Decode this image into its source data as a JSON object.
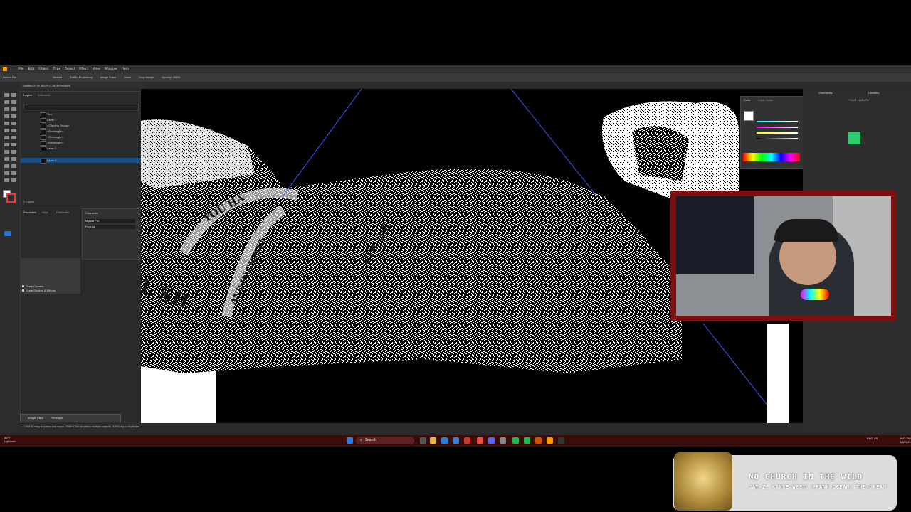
{
  "menu": [
    "File",
    "Edit",
    "Object",
    "Type",
    "Select",
    "Effect",
    "View",
    "Window",
    "Help"
  ],
  "control_bar": {
    "selection": "Linked File",
    "buttons": [
      "Embed",
      "Edit In Photoshop",
      "Image Trace",
      "Mask",
      "Crop Image",
      "Opacity: 100%"
    ]
  },
  "document_tab": "Untitled-1* @ 300 % (CMYK/Preview)",
  "layers_panel": {
    "tabs": [
      "Layers",
      "Artboards"
    ],
    "rows": [
      {
        "name": "Text",
        "selected": false
      },
      {
        "name": "Layer 1",
        "selected": false
      },
      {
        "name": "<Clipping Group>",
        "selected": false
      },
      {
        "name": "<Rectangle>",
        "selected": false
      },
      {
        "name": "<Rectangle>",
        "selected": false
      },
      {
        "name": "<Rectangle>",
        "selected": false
      },
      {
        "name": "Layer 2",
        "selected": false
      },
      {
        "name": "Layer 3",
        "selected": true
      }
    ],
    "count": "3 Layers"
  },
  "props_panel": {
    "tabs": [
      "Properties",
      "Align",
      "Pathfinder"
    ],
    "character_title": "Character",
    "font": "Myriad Pro",
    "style": "Regular",
    "checkboxes": [
      "Scale Corners",
      "Scale Strokes & Effects"
    ]
  },
  "image_trace": {
    "label": "Image Trace",
    "btn": "Reshape"
  },
  "status_text": "Click & drag to select and move, Shift+Click to select multiple objects, Alt+Drag to duplicate",
  "color_panel": {
    "tabs": [
      "Color",
      "Color Guide"
    ]
  },
  "right_panel": {
    "tabs": [
      "Comments",
      "Libraries"
    ],
    "library": "YOUR LIBRARY",
    "swatch_color": "#2ecc71"
  },
  "taskbar": {
    "weather_temp": "59°F",
    "weather_desc": "Light rain",
    "search": "Search",
    "time": "8:43 PM",
    "date": "5/5/2024",
    "lang": "ENG US"
  },
  "now_playing": {
    "title": "NO CHURCH IN THE WILD",
    "artist": "JAY-Z, KANYE WEST, FRANK OCEAN, THE-DREAM"
  },
  "canvas_tattoo_text": [
    "M·EL SH",
    "YOU HA",
    "AND IN CHRIST",
    "COL 2:9"
  ]
}
